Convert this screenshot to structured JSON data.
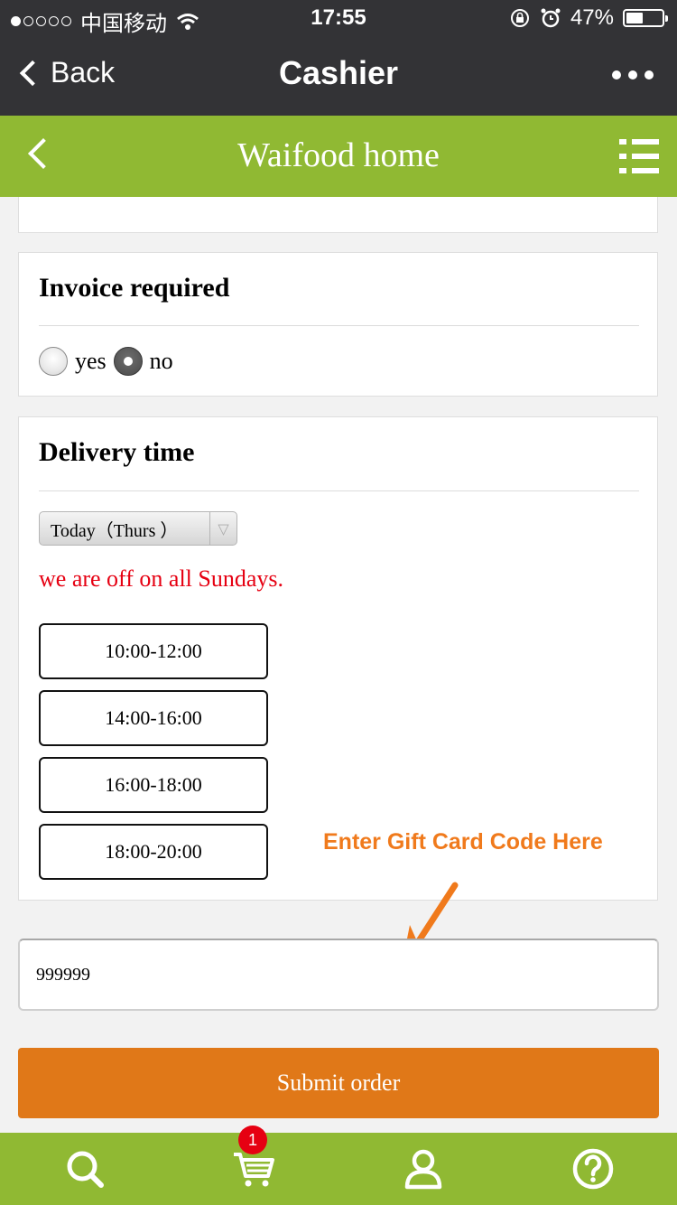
{
  "status_bar": {
    "carrier": "中国移动",
    "time": "17:55",
    "battery": "47%"
  },
  "nav": {
    "back_label": "Back",
    "title": "Cashier"
  },
  "header": {
    "title": "Waifood home"
  },
  "invoice": {
    "title": "Invoice required",
    "options": [
      "yes",
      "no"
    ],
    "selected": "no"
  },
  "delivery": {
    "title": "Delivery time",
    "day_select": "Today（Thurs ）",
    "notice": "we are off on all Sundays.",
    "slots": [
      "10:00-12:00",
      "14:00-16:00",
      "16:00-18:00",
      "18:00-20:00"
    ]
  },
  "annotation": "Enter Gift Card Code Here",
  "gift_card": {
    "value": "999999"
  },
  "submit": {
    "label": "Submit order"
  },
  "tabs": {
    "cart_count": "1"
  },
  "colors": {
    "green": "#90b933",
    "orange": "#e07818",
    "red": "#e60012",
    "annotation": "#f07a1c"
  }
}
